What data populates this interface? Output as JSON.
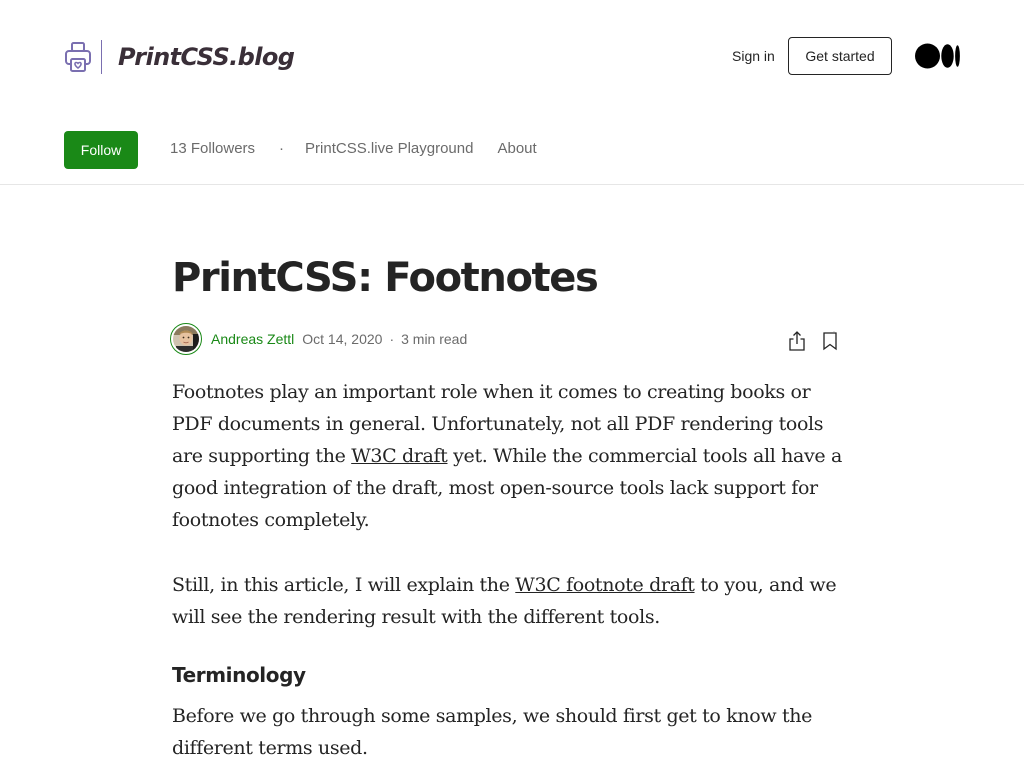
{
  "publication": {
    "name": "PrintCSS.blog",
    "icon": "printer-heart-icon"
  },
  "header": {
    "sign_in": "Sign in",
    "get_started": "Get started",
    "medium_logo": "medium-logo-icon"
  },
  "nav": {
    "follow": "Follow",
    "followers": "13 Followers",
    "separator": "·",
    "playground": "PrintCSS.live Playground",
    "about": "About"
  },
  "article": {
    "title": "PrintCSS: Footnotes",
    "author": "Andreas Zettl",
    "date": "Oct 14, 2020",
    "meta_separator": "·",
    "read_time": "3 min read",
    "p1": {
      "before_link": "Footnotes play an important role when it comes to creating books or PDF documents in general. Unfortunately, not all PDF rendering tools are supporting the ",
      "link": "W3C draft",
      "after_link": " yet. While the commercial tools all have a good integration of the draft, most open-source tools lack support for footnotes completely."
    },
    "p2": {
      "before_link": "Still, in this article, I will explain the ",
      "link": "W3C footnote draft",
      "after_link": " to you, and we will see the rendering result with the different tools."
    },
    "subheading": "Terminology",
    "p3": "Before we go through some samples, we should first get to know the different terms used."
  },
  "colors": {
    "accent_green": "#1a8917",
    "text": "#242424",
    "muted": "#6b6b6b",
    "logo_purple": "#7a6fb0"
  }
}
